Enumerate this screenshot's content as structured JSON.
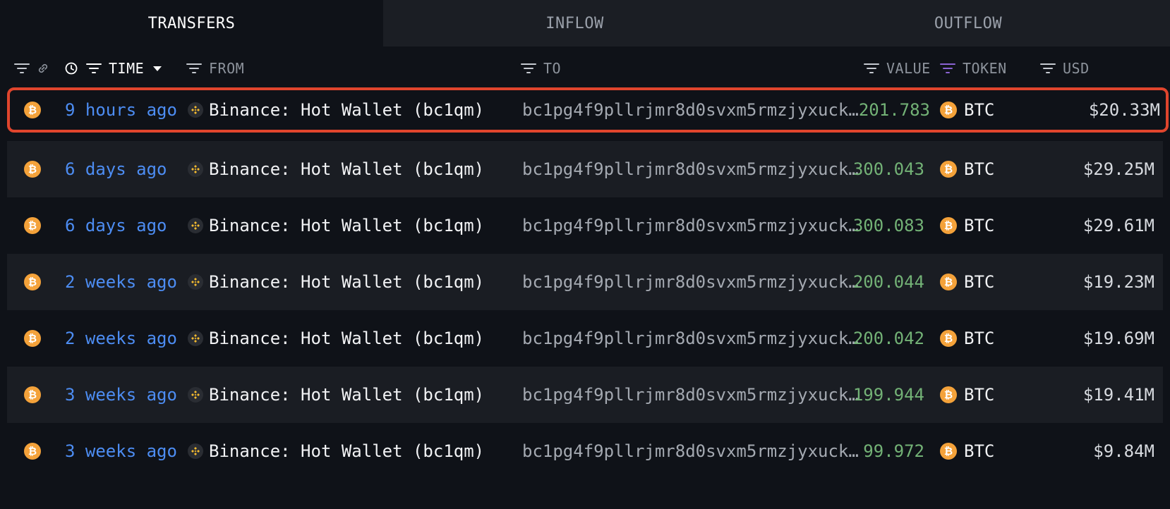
{
  "tabs": [
    {
      "label": "TRANSFERS",
      "active": true
    },
    {
      "label": "INFLOW",
      "active": false
    },
    {
      "label": "OUTFLOW",
      "active": false
    }
  ],
  "columns": {
    "time": "TIME",
    "from": "FROM",
    "to": "TO",
    "value": "VALUE",
    "token": "TOKEN",
    "usd": "USD"
  },
  "colors": {
    "highlight_border": "#e0452d",
    "time_link": "#4d8df3",
    "value_green": "#73b276",
    "btc_orange": "#f4a23a",
    "token_filter_active": "#8a63d2"
  },
  "rows": [
    {
      "time": "9 hours ago",
      "from": "Binance: Hot Wallet (bc1qm)",
      "to": "bc1pg4f9pllrjmr8d0svxm5rmzjyxuck…",
      "value": "201.783",
      "token": "BTC",
      "usd": "$20.33M",
      "highlighted": true
    },
    {
      "time": "6 days ago",
      "from": "Binance: Hot Wallet (bc1qm)",
      "to": "bc1pg4f9pllrjmr8d0svxm5rmzjyxuck…",
      "value": "300.043",
      "token": "BTC",
      "usd": "$29.25M"
    },
    {
      "time": "6 days ago",
      "from": "Binance: Hot Wallet (bc1qm)",
      "to": "bc1pg4f9pllrjmr8d0svxm5rmzjyxuck…",
      "value": "300.083",
      "token": "BTC",
      "usd": "$29.61M"
    },
    {
      "time": "2 weeks ago",
      "from": "Binance: Hot Wallet (bc1qm)",
      "to": "bc1pg4f9pllrjmr8d0svxm5rmzjyxuck…",
      "value": "200.044",
      "token": "BTC",
      "usd": "$19.23M"
    },
    {
      "time": "2 weeks ago",
      "from": "Binance: Hot Wallet (bc1qm)",
      "to": "bc1pg4f9pllrjmr8d0svxm5rmzjyxuck…",
      "value": "200.042",
      "token": "BTC",
      "usd": "$19.69M"
    },
    {
      "time": "3 weeks ago",
      "from": "Binance: Hot Wallet (bc1qm)",
      "to": "bc1pg4f9pllrjmr8d0svxm5rmzjyxuck…",
      "value": "199.944",
      "token": "BTC",
      "usd": "$19.41M"
    },
    {
      "time": "3 weeks ago",
      "from": "Binance: Hot Wallet (bc1qm)",
      "to": "bc1pg4f9pllrjmr8d0svxm5rmzjyxuck…",
      "value": "99.972",
      "token": "BTC",
      "usd": "$9.84M"
    }
  ],
  "icons": {
    "row_chain": "bitcoin-icon",
    "from_entity": "binance-icon",
    "token": "bitcoin-icon"
  }
}
